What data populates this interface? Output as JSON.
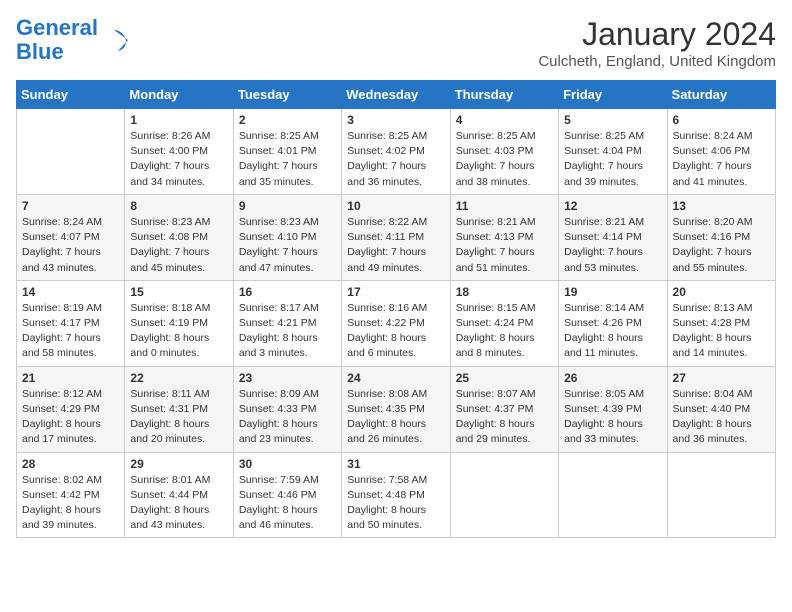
{
  "header": {
    "logo_line1": "General",
    "logo_line2": "Blue",
    "month": "January 2024",
    "location": "Culcheth, England, United Kingdom"
  },
  "weekdays": [
    "Sunday",
    "Monday",
    "Tuesday",
    "Wednesday",
    "Thursday",
    "Friday",
    "Saturday"
  ],
  "weeks": [
    [
      {
        "day": "",
        "sunrise": "",
        "sunset": "",
        "daylight": ""
      },
      {
        "day": "1",
        "sunrise": "Sunrise: 8:26 AM",
        "sunset": "Sunset: 4:00 PM",
        "daylight": "Daylight: 7 hours and 34 minutes."
      },
      {
        "day": "2",
        "sunrise": "Sunrise: 8:25 AM",
        "sunset": "Sunset: 4:01 PM",
        "daylight": "Daylight: 7 hours and 35 minutes."
      },
      {
        "day": "3",
        "sunrise": "Sunrise: 8:25 AM",
        "sunset": "Sunset: 4:02 PM",
        "daylight": "Daylight: 7 hours and 36 minutes."
      },
      {
        "day": "4",
        "sunrise": "Sunrise: 8:25 AM",
        "sunset": "Sunset: 4:03 PM",
        "daylight": "Daylight: 7 hours and 38 minutes."
      },
      {
        "day": "5",
        "sunrise": "Sunrise: 8:25 AM",
        "sunset": "Sunset: 4:04 PM",
        "daylight": "Daylight: 7 hours and 39 minutes."
      },
      {
        "day": "6",
        "sunrise": "Sunrise: 8:24 AM",
        "sunset": "Sunset: 4:06 PM",
        "daylight": "Daylight: 7 hours and 41 minutes."
      }
    ],
    [
      {
        "day": "7",
        "sunrise": "Sunrise: 8:24 AM",
        "sunset": "Sunset: 4:07 PM",
        "daylight": "Daylight: 7 hours and 43 minutes."
      },
      {
        "day": "8",
        "sunrise": "Sunrise: 8:23 AM",
        "sunset": "Sunset: 4:08 PM",
        "daylight": "Daylight: 7 hours and 45 minutes."
      },
      {
        "day": "9",
        "sunrise": "Sunrise: 8:23 AM",
        "sunset": "Sunset: 4:10 PM",
        "daylight": "Daylight: 7 hours and 47 minutes."
      },
      {
        "day": "10",
        "sunrise": "Sunrise: 8:22 AM",
        "sunset": "Sunset: 4:11 PM",
        "daylight": "Daylight: 7 hours and 49 minutes."
      },
      {
        "day": "11",
        "sunrise": "Sunrise: 8:21 AM",
        "sunset": "Sunset: 4:13 PM",
        "daylight": "Daylight: 7 hours and 51 minutes."
      },
      {
        "day": "12",
        "sunrise": "Sunrise: 8:21 AM",
        "sunset": "Sunset: 4:14 PM",
        "daylight": "Daylight: 7 hours and 53 minutes."
      },
      {
        "day": "13",
        "sunrise": "Sunrise: 8:20 AM",
        "sunset": "Sunset: 4:16 PM",
        "daylight": "Daylight: 7 hours and 55 minutes."
      }
    ],
    [
      {
        "day": "14",
        "sunrise": "Sunrise: 8:19 AM",
        "sunset": "Sunset: 4:17 PM",
        "daylight": "Daylight: 7 hours and 58 minutes."
      },
      {
        "day": "15",
        "sunrise": "Sunrise: 8:18 AM",
        "sunset": "Sunset: 4:19 PM",
        "daylight": "Daylight: 8 hours and 0 minutes."
      },
      {
        "day": "16",
        "sunrise": "Sunrise: 8:17 AM",
        "sunset": "Sunset: 4:21 PM",
        "daylight": "Daylight: 8 hours and 3 minutes."
      },
      {
        "day": "17",
        "sunrise": "Sunrise: 8:16 AM",
        "sunset": "Sunset: 4:22 PM",
        "daylight": "Daylight: 8 hours and 6 minutes."
      },
      {
        "day": "18",
        "sunrise": "Sunrise: 8:15 AM",
        "sunset": "Sunset: 4:24 PM",
        "daylight": "Daylight: 8 hours and 8 minutes."
      },
      {
        "day": "19",
        "sunrise": "Sunrise: 8:14 AM",
        "sunset": "Sunset: 4:26 PM",
        "daylight": "Daylight: 8 hours and 11 minutes."
      },
      {
        "day": "20",
        "sunrise": "Sunrise: 8:13 AM",
        "sunset": "Sunset: 4:28 PM",
        "daylight": "Daylight: 8 hours and 14 minutes."
      }
    ],
    [
      {
        "day": "21",
        "sunrise": "Sunrise: 8:12 AM",
        "sunset": "Sunset: 4:29 PM",
        "daylight": "Daylight: 8 hours and 17 minutes."
      },
      {
        "day": "22",
        "sunrise": "Sunrise: 8:11 AM",
        "sunset": "Sunset: 4:31 PM",
        "daylight": "Daylight: 8 hours and 20 minutes."
      },
      {
        "day": "23",
        "sunrise": "Sunrise: 8:09 AM",
        "sunset": "Sunset: 4:33 PM",
        "daylight": "Daylight: 8 hours and 23 minutes."
      },
      {
        "day": "24",
        "sunrise": "Sunrise: 8:08 AM",
        "sunset": "Sunset: 4:35 PM",
        "daylight": "Daylight: 8 hours and 26 minutes."
      },
      {
        "day": "25",
        "sunrise": "Sunrise: 8:07 AM",
        "sunset": "Sunset: 4:37 PM",
        "daylight": "Daylight: 8 hours and 29 minutes."
      },
      {
        "day": "26",
        "sunrise": "Sunrise: 8:05 AM",
        "sunset": "Sunset: 4:39 PM",
        "daylight": "Daylight: 8 hours and 33 minutes."
      },
      {
        "day": "27",
        "sunrise": "Sunrise: 8:04 AM",
        "sunset": "Sunset: 4:40 PM",
        "daylight": "Daylight: 8 hours and 36 minutes."
      }
    ],
    [
      {
        "day": "28",
        "sunrise": "Sunrise: 8:02 AM",
        "sunset": "Sunset: 4:42 PM",
        "daylight": "Daylight: 8 hours and 39 minutes."
      },
      {
        "day": "29",
        "sunrise": "Sunrise: 8:01 AM",
        "sunset": "Sunset: 4:44 PM",
        "daylight": "Daylight: 8 hours and 43 minutes."
      },
      {
        "day": "30",
        "sunrise": "Sunrise: 7:59 AM",
        "sunset": "Sunset: 4:46 PM",
        "daylight": "Daylight: 8 hours and 46 minutes."
      },
      {
        "day": "31",
        "sunrise": "Sunrise: 7:58 AM",
        "sunset": "Sunset: 4:48 PM",
        "daylight": "Daylight: 8 hours and 50 minutes."
      },
      {
        "day": "",
        "sunrise": "",
        "sunset": "",
        "daylight": ""
      },
      {
        "day": "",
        "sunrise": "",
        "sunset": "",
        "daylight": ""
      },
      {
        "day": "",
        "sunrise": "",
        "sunset": "",
        "daylight": ""
      }
    ]
  ]
}
